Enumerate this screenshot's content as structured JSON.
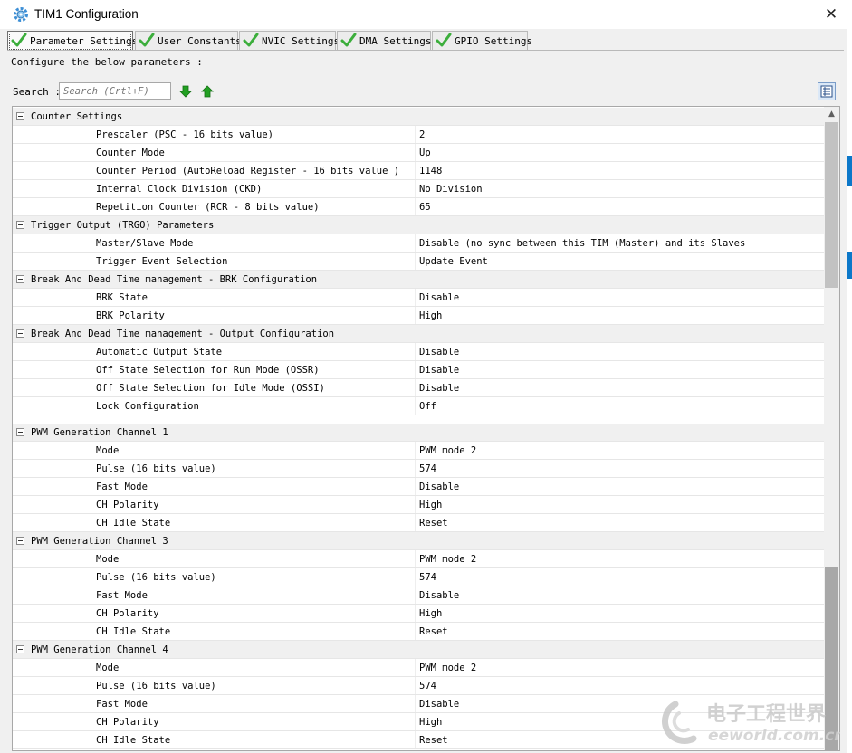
{
  "window": {
    "title": "TIM1 Configuration"
  },
  "tabs": [
    {
      "label": "Parameter Settings"
    },
    {
      "label": "User Constants"
    },
    {
      "label": "NVIC Settings"
    },
    {
      "label": "DMA Settings"
    },
    {
      "label": "GPIO Settings"
    }
  ],
  "configure_text": "Configure the below parameters :",
  "search": {
    "label": "Search :",
    "placeholder": "Search (Crtl+F)"
  },
  "groups": [
    {
      "title": "Counter Settings",
      "params": [
        {
          "label": "Prescaler (PSC - 16 bits value)",
          "value": "2"
        },
        {
          "label": "Counter Mode",
          "value": "Up"
        },
        {
          "label": "Counter Period (AutoReload Register - 16 bits value )",
          "value": "1148"
        },
        {
          "label": "Internal Clock Division (CKD)",
          "value": "No Division"
        },
        {
          "label": "Repetition Counter (RCR - 8 bits value)",
          "value": "65"
        }
      ]
    },
    {
      "title": "Trigger Output (TRGO) Parameters",
      "params": [
        {
          "label": "Master/Slave Mode",
          "value": "Disable (no sync between this TIM (Master) and its Slaves"
        },
        {
          "label": "Trigger Event Selection",
          "value": "Update Event"
        }
      ]
    },
    {
      "title": "Break And Dead Time management - BRK Configuration",
      "params": [
        {
          "label": "BRK State",
          "value": "Disable"
        },
        {
          "label": "BRK Polarity",
          "value": "High"
        }
      ]
    },
    {
      "title": "Break And Dead Time management - Output Configuration",
      "params": [
        {
          "label": "Automatic Output State",
          "value": "Disable"
        },
        {
          "label": "Off State Selection for Run Mode (OSSR)",
          "value": "Disable"
        },
        {
          "label": "Off State Selection for Idle Mode (OSSI)",
          "value": "Disable"
        },
        {
          "label": "Lock Configuration",
          "value": "Off"
        }
      ]
    },
    {
      "title": "PWM Generation Channel 1",
      "params": [
        {
          "label": "Mode",
          "value": "PWM mode 2"
        },
        {
          "label": "Pulse (16 bits value)",
          "value": "574"
        },
        {
          "label": "Fast Mode",
          "value": "Disable"
        },
        {
          "label": "CH Polarity",
          "value": "High"
        },
        {
          "label": "CH Idle State",
          "value": "Reset"
        }
      ]
    },
    {
      "title": "PWM Generation Channel 3",
      "params": [
        {
          "label": "Mode",
          "value": "PWM mode 2"
        },
        {
          "label": "Pulse (16 bits value)",
          "value": "574"
        },
        {
          "label": "Fast Mode",
          "value": "Disable"
        },
        {
          "label": "CH Polarity",
          "value": "High"
        },
        {
          "label": "CH Idle State",
          "value": "Reset"
        }
      ]
    },
    {
      "title": "PWM Generation Channel 4",
      "params": [
        {
          "label": "Mode",
          "value": "PWM mode 2"
        },
        {
          "label": "Pulse (16 bits value)",
          "value": "574"
        },
        {
          "label": "Fast Mode",
          "value": "Disable"
        },
        {
          "label": "CH Polarity",
          "value": "High"
        },
        {
          "label": "CH Idle State",
          "value": "Reset"
        }
      ]
    }
  ],
  "watermark": {
    "brand": "电子工程世界",
    "site": "eeworld.com.cn"
  },
  "colors": {
    "check_green": "#3cae3c",
    "arrow_green": "#22a022",
    "accent_blue": "#0c78c9"
  },
  "icons": {
    "title": "gear-icon",
    "tab": "green-check-icon",
    "next": "arrow-down-icon",
    "prev": "arrow-up-icon",
    "view": "list-view-icon"
  }
}
